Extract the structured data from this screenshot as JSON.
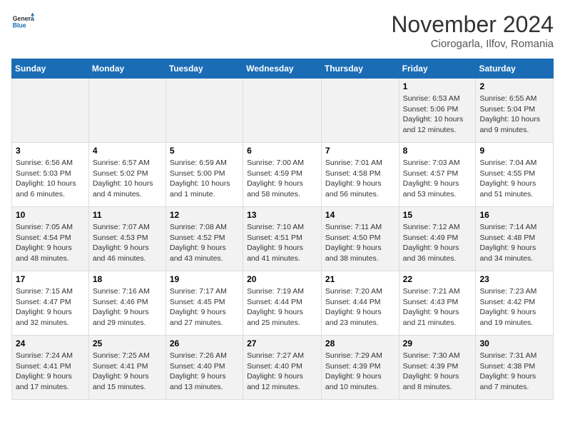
{
  "logo": {
    "general": "General",
    "blue": "Blue"
  },
  "header": {
    "month_year": "November 2024",
    "location": "Ciorogarla, Ilfov, Romania"
  },
  "weekdays": [
    "Sunday",
    "Monday",
    "Tuesday",
    "Wednesday",
    "Thursday",
    "Friday",
    "Saturday"
  ],
  "weeks": [
    [
      {
        "day": "",
        "info": ""
      },
      {
        "day": "",
        "info": ""
      },
      {
        "day": "",
        "info": ""
      },
      {
        "day": "",
        "info": ""
      },
      {
        "day": "",
        "info": ""
      },
      {
        "day": "1",
        "info": "Sunrise: 6:53 AM\nSunset: 5:06 PM\nDaylight: 10 hours and 12 minutes."
      },
      {
        "day": "2",
        "info": "Sunrise: 6:55 AM\nSunset: 5:04 PM\nDaylight: 10 hours and 9 minutes."
      }
    ],
    [
      {
        "day": "3",
        "info": "Sunrise: 6:56 AM\nSunset: 5:03 PM\nDaylight: 10 hours and 6 minutes."
      },
      {
        "day": "4",
        "info": "Sunrise: 6:57 AM\nSunset: 5:02 PM\nDaylight: 10 hours and 4 minutes."
      },
      {
        "day": "5",
        "info": "Sunrise: 6:59 AM\nSunset: 5:00 PM\nDaylight: 10 hours and 1 minute."
      },
      {
        "day": "6",
        "info": "Sunrise: 7:00 AM\nSunset: 4:59 PM\nDaylight: 9 hours and 58 minutes."
      },
      {
        "day": "7",
        "info": "Sunrise: 7:01 AM\nSunset: 4:58 PM\nDaylight: 9 hours and 56 minutes."
      },
      {
        "day": "8",
        "info": "Sunrise: 7:03 AM\nSunset: 4:57 PM\nDaylight: 9 hours and 53 minutes."
      },
      {
        "day": "9",
        "info": "Sunrise: 7:04 AM\nSunset: 4:55 PM\nDaylight: 9 hours and 51 minutes."
      }
    ],
    [
      {
        "day": "10",
        "info": "Sunrise: 7:05 AM\nSunset: 4:54 PM\nDaylight: 9 hours and 48 minutes."
      },
      {
        "day": "11",
        "info": "Sunrise: 7:07 AM\nSunset: 4:53 PM\nDaylight: 9 hours and 46 minutes."
      },
      {
        "day": "12",
        "info": "Sunrise: 7:08 AM\nSunset: 4:52 PM\nDaylight: 9 hours and 43 minutes."
      },
      {
        "day": "13",
        "info": "Sunrise: 7:10 AM\nSunset: 4:51 PM\nDaylight: 9 hours and 41 minutes."
      },
      {
        "day": "14",
        "info": "Sunrise: 7:11 AM\nSunset: 4:50 PM\nDaylight: 9 hours and 38 minutes."
      },
      {
        "day": "15",
        "info": "Sunrise: 7:12 AM\nSunset: 4:49 PM\nDaylight: 9 hours and 36 minutes."
      },
      {
        "day": "16",
        "info": "Sunrise: 7:14 AM\nSunset: 4:48 PM\nDaylight: 9 hours and 34 minutes."
      }
    ],
    [
      {
        "day": "17",
        "info": "Sunrise: 7:15 AM\nSunset: 4:47 PM\nDaylight: 9 hours and 32 minutes."
      },
      {
        "day": "18",
        "info": "Sunrise: 7:16 AM\nSunset: 4:46 PM\nDaylight: 9 hours and 29 minutes."
      },
      {
        "day": "19",
        "info": "Sunrise: 7:17 AM\nSunset: 4:45 PM\nDaylight: 9 hours and 27 minutes."
      },
      {
        "day": "20",
        "info": "Sunrise: 7:19 AM\nSunset: 4:44 PM\nDaylight: 9 hours and 25 minutes."
      },
      {
        "day": "21",
        "info": "Sunrise: 7:20 AM\nSunset: 4:44 PM\nDaylight: 9 hours and 23 minutes."
      },
      {
        "day": "22",
        "info": "Sunrise: 7:21 AM\nSunset: 4:43 PM\nDaylight: 9 hours and 21 minutes."
      },
      {
        "day": "23",
        "info": "Sunrise: 7:23 AM\nSunset: 4:42 PM\nDaylight: 9 hours and 19 minutes."
      }
    ],
    [
      {
        "day": "24",
        "info": "Sunrise: 7:24 AM\nSunset: 4:41 PM\nDaylight: 9 hours and 17 minutes."
      },
      {
        "day": "25",
        "info": "Sunrise: 7:25 AM\nSunset: 4:41 PM\nDaylight: 9 hours and 15 minutes."
      },
      {
        "day": "26",
        "info": "Sunrise: 7:26 AM\nSunset: 4:40 PM\nDaylight: 9 hours and 13 minutes."
      },
      {
        "day": "27",
        "info": "Sunrise: 7:27 AM\nSunset: 4:40 PM\nDaylight: 9 hours and 12 minutes."
      },
      {
        "day": "28",
        "info": "Sunrise: 7:29 AM\nSunset: 4:39 PM\nDaylight: 9 hours and 10 minutes."
      },
      {
        "day": "29",
        "info": "Sunrise: 7:30 AM\nSunset: 4:39 PM\nDaylight: 9 hours and 8 minutes."
      },
      {
        "day": "30",
        "info": "Sunrise: 7:31 AM\nSunset: 4:38 PM\nDaylight: 9 hours and 7 minutes."
      }
    ]
  ]
}
